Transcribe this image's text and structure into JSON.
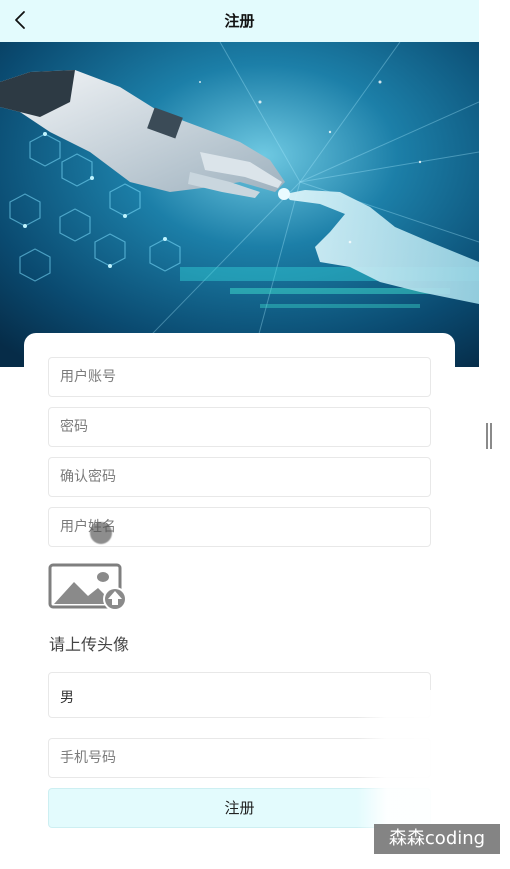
{
  "header": {
    "title": "注册",
    "back_icon": "chevron-left-icon"
  },
  "hero": {
    "image": "robot-hand-touching-human-hand-illustration"
  },
  "form": {
    "account_placeholder": "用户账号",
    "password_placeholder": "密码",
    "confirm_password_placeholder": "确认密码",
    "name_placeholder": "用户姓名",
    "avatar_icon": "image-upload-icon",
    "avatar_label": "请上传头像",
    "gender_value": "男",
    "phone_placeholder": "手机号码",
    "submit_label": "注册"
  },
  "colors": {
    "header_bg": "#e3fbfd",
    "button_bg": "#e3fbfd",
    "hero_primary": "#0b4b6e"
  },
  "watermark": {
    "text": "森森coding"
  }
}
